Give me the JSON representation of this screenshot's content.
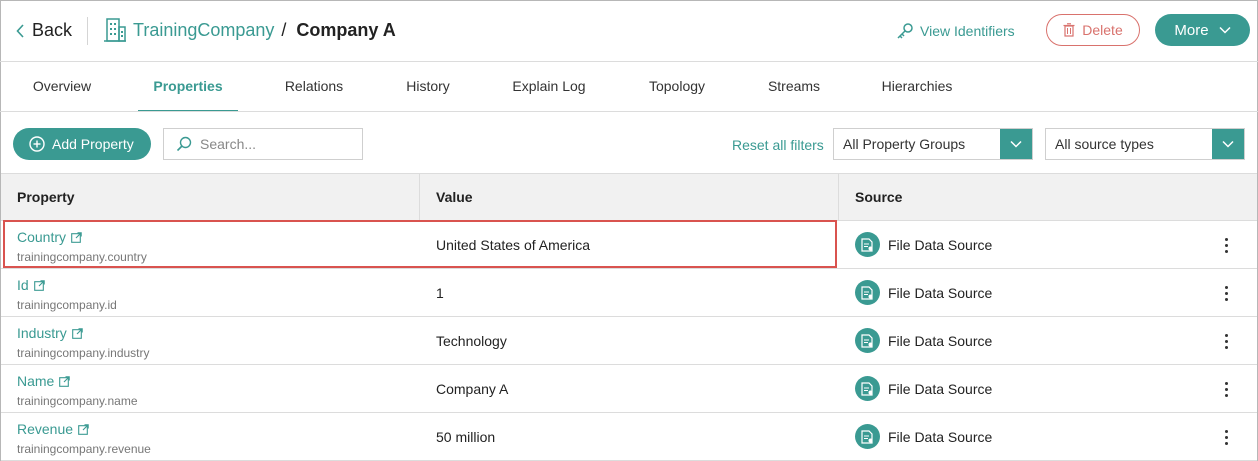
{
  "header": {
    "back_label": "Back",
    "breadcrumb_parent": "TrainingCompany",
    "breadcrumb_sep": "/",
    "breadcrumb_current": "Company A",
    "view_identifiers_label": "View Identifiers",
    "delete_label": "Delete",
    "more_label": "More"
  },
  "tabs": [
    {
      "label": "Overview",
      "active": false
    },
    {
      "label": "Properties",
      "active": true
    },
    {
      "label": "Relations",
      "active": false
    },
    {
      "label": "History",
      "active": false
    },
    {
      "label": "Explain Log",
      "active": false
    },
    {
      "label": "Topology",
      "active": false
    },
    {
      "label": "Streams",
      "active": false
    },
    {
      "label": "Hierarchies",
      "active": false
    }
  ],
  "toolbar": {
    "add_property_label": "Add Property",
    "search_placeholder": "Search...",
    "reset_filters_label": "Reset all filters",
    "property_groups_value": "All Property Groups",
    "source_types_value": "All source types"
  },
  "table": {
    "columns": [
      "Property",
      "Value",
      "Source"
    ],
    "rows": [
      {
        "name": "Country",
        "key": "trainingcompany.country",
        "value": "United States of America",
        "source": "File Data Source",
        "highlighted": true
      },
      {
        "name": "Id",
        "key": "trainingcompany.id",
        "value": "1",
        "source": "File Data Source",
        "highlighted": false
      },
      {
        "name": "Industry",
        "key": "trainingcompany.industry",
        "value": "Technology",
        "source": "File Data Source",
        "highlighted": false
      },
      {
        "name": "Name",
        "key": "trainingcompany.name",
        "value": "Company A",
        "source": "File Data Source",
        "highlighted": false
      },
      {
        "name": "Revenue",
        "key": "trainingcompany.revenue",
        "value": "50 million",
        "source": "File Data Source",
        "highlighted": false
      }
    ]
  },
  "colors": {
    "accent": "#3a9a92",
    "danger": "#d9726d",
    "highlight_border": "#d9534f",
    "header_bg": "#f1f1f1"
  },
  "icons": {
    "back": "chevron-left-icon",
    "entity": "building-icon",
    "identifiers": "key-icon",
    "delete": "trash-icon",
    "more": "chevron-down-icon",
    "add": "plus-circle-icon",
    "search": "search-icon",
    "external": "external-link-icon",
    "source": "file-data-source-icon",
    "row_menu": "kebab-icon"
  }
}
